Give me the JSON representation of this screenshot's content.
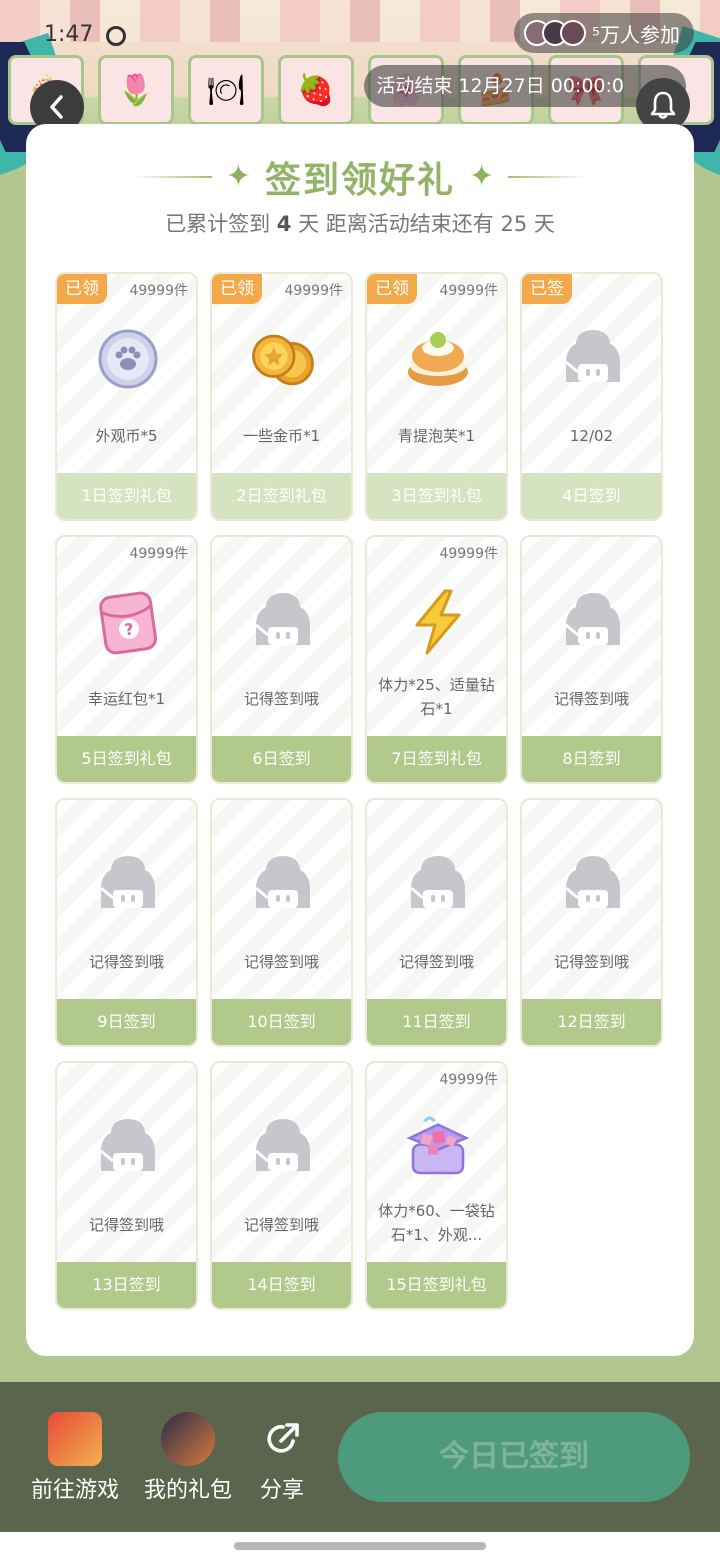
{
  "status_bar": {
    "time": "1:47"
  },
  "header": {
    "participants_text": "⁵万人参加",
    "activity_end": "活动结束 12月27日 00:00:0"
  },
  "card": {
    "title": "签到领好礼",
    "subtitle_prefix": "已累计签到",
    "signed_days": "4",
    "subtitle_mid": "天  距离活动结束还有",
    "days_left": "25",
    "subtitle_suffix": "天"
  },
  "days": [
    {
      "badge": "已领",
      "qty": "49999件",
      "icon": "paw-coin-icon",
      "name": "外观币*5",
      "label": "1日签到礼包",
      "done": true
    },
    {
      "badge": "已领",
      "qty": "49999件",
      "icon": "gold-coins-icon",
      "name": "一些金币*1",
      "label": "2日签到礼包",
      "done": true
    },
    {
      "badge": "已领",
      "qty": "49999件",
      "icon": "cream-puff-icon",
      "name": "青提泡芙*1",
      "label": "3日签到礼包",
      "done": true
    },
    {
      "badge": "已签",
      "qty": "",
      "icon": "placeholder-character-icon",
      "name": "12/02",
      "label": "4日签到",
      "done": true
    },
    {
      "badge": "",
      "qty": "49999件",
      "icon": "lucky-envelope-icon",
      "name": "幸运红包*1",
      "label": "5日签到礼包",
      "done": false
    },
    {
      "badge": "",
      "qty": "",
      "icon": "placeholder-character-icon",
      "name": "记得签到哦",
      "label": "6日签到",
      "done": false
    },
    {
      "badge": "",
      "qty": "49999件",
      "icon": "lightning-icon",
      "name": "体力*25、适量钻石*1",
      "label": "7日签到礼包",
      "done": false
    },
    {
      "badge": "",
      "qty": "",
      "icon": "placeholder-character-icon",
      "name": "记得签到哦",
      "label": "8日签到",
      "done": false
    },
    {
      "badge": "",
      "qty": "",
      "icon": "placeholder-character-icon",
      "name": "记得签到哦",
      "label": "9日签到",
      "done": false
    },
    {
      "badge": "",
      "qty": "",
      "icon": "placeholder-character-icon",
      "name": "记得签到哦",
      "label": "10日签到",
      "done": false
    },
    {
      "badge": "",
      "qty": "",
      "icon": "placeholder-character-icon",
      "name": "记得签到哦",
      "label": "11日签到",
      "done": false
    },
    {
      "badge": "",
      "qty": "",
      "icon": "placeholder-character-icon",
      "name": "记得签到哦",
      "label": "12日签到",
      "done": false
    },
    {
      "badge": "",
      "qty": "",
      "icon": "placeholder-character-icon",
      "name": "记得签到哦",
      "label": "13日签到",
      "done": false
    },
    {
      "badge": "",
      "qty": "",
      "icon": "placeholder-character-icon",
      "name": "记得签到哦",
      "label": "14日签到",
      "done": false
    },
    {
      "badge": "",
      "qty": "49999件",
      "icon": "gem-chest-icon",
      "name": "体力*60、一袋钻石*1、外观...",
      "label": "15日签到礼包",
      "done": false
    }
  ],
  "bottom_bar": {
    "goto_game": "前往游戏",
    "my_gifts": "我的礼包",
    "share": "分享",
    "signed_button": "今日已签到"
  }
}
